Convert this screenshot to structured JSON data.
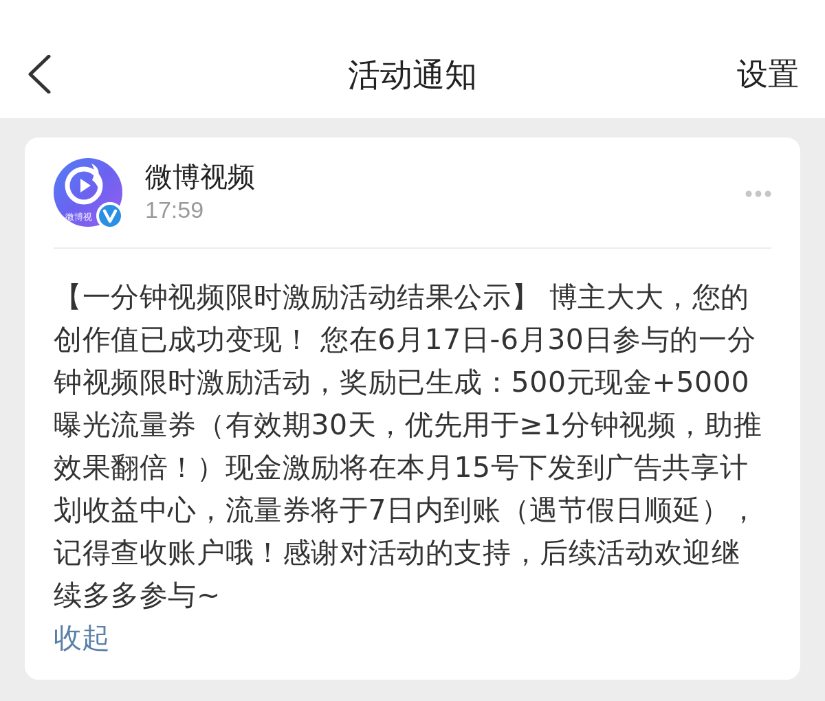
{
  "header": {
    "title": "活动通知",
    "action": "设置"
  },
  "notification": {
    "sender": "微博视频",
    "avatar_label": "微博视",
    "verified": true,
    "time": "17:59",
    "body": "【一分钟视频限时激励活动结果公示】 博主大大，您的创作值已成功变现！ 您在6月17日-6月30日参与的一分钟视频限时激励活动，奖励已生成：500元现金+5000曝光流量券（有效期30天，优先用于≥1分钟视频，助推效果翻倍！）现金激励将在本月15号下发到广告共享计划收益中心，流量券将于7日内到账（遇节假日顺延），记得查收账户哦！感谢对活动的支持，后续活动欢迎继续多多参与~",
    "collapse_link": "收起"
  }
}
